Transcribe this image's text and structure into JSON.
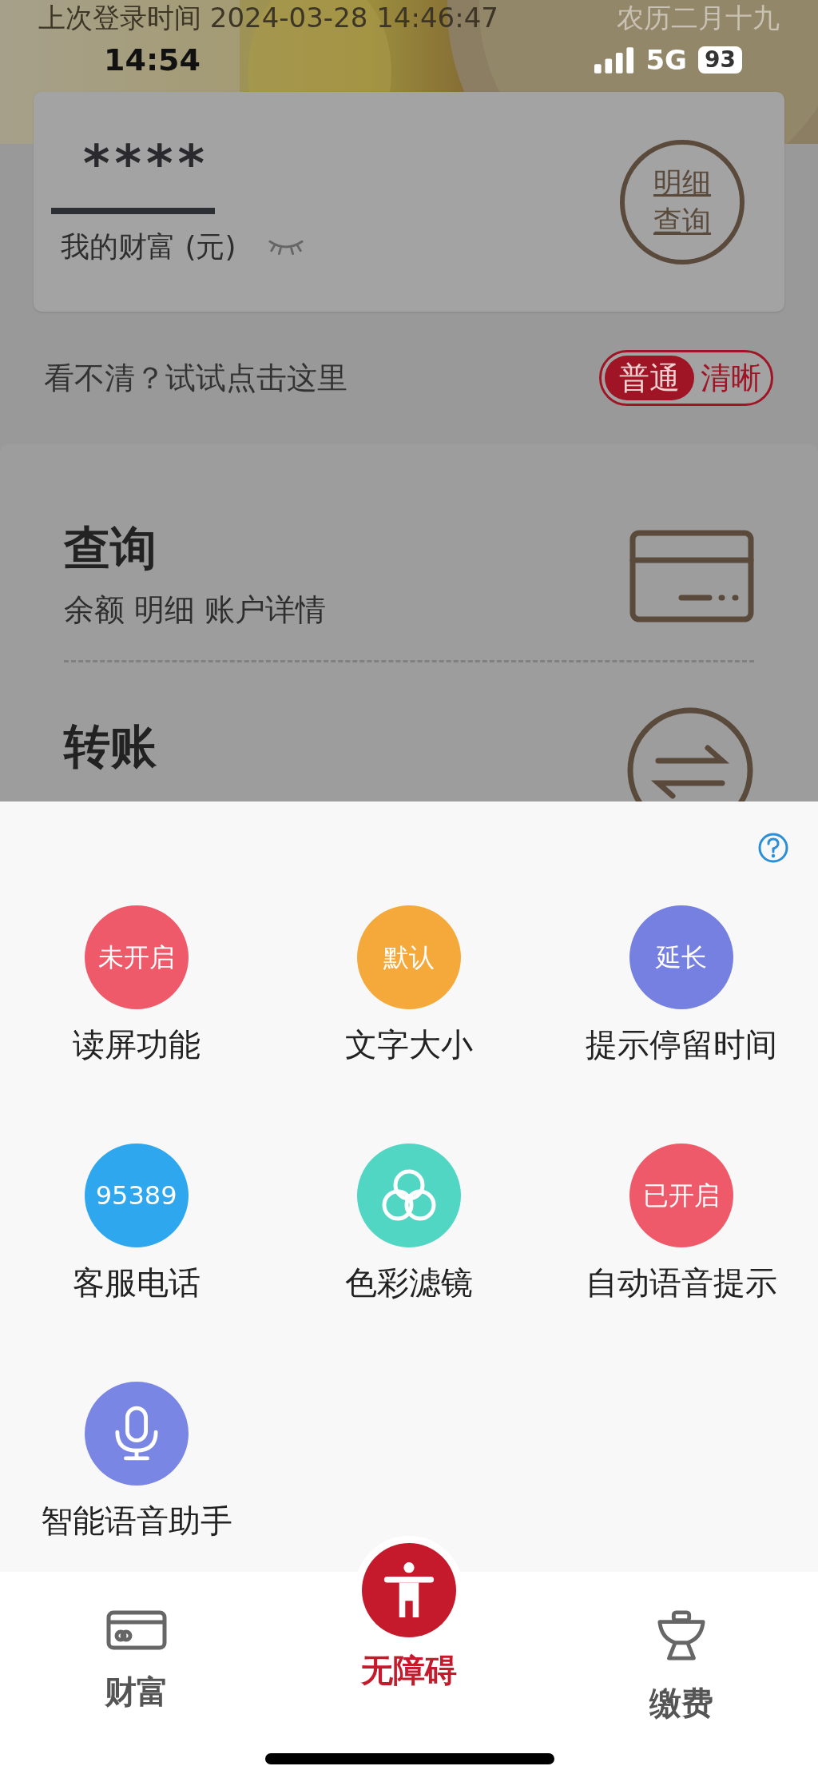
{
  "status_bar": {
    "last_login": "上次登录时间 2024-03-28 14:46:47",
    "lunar_date": "农历二月十九",
    "time": "14:54",
    "network": "5G",
    "battery": "93"
  },
  "wealth_card": {
    "amount": "****",
    "label": "我的财富 (元)",
    "detail_button": "明细查询"
  },
  "clarity": {
    "hint": "看不清？试试点击这里",
    "options": [
      {
        "label": "普通",
        "selected": true
      },
      {
        "label": "清晰",
        "selected": false
      }
    ]
  },
  "services": [
    {
      "kind": "card",
      "title": "查询",
      "subtitle": "余额 明细 账户详情"
    },
    {
      "kind": "transfer",
      "title": "转账"
    }
  ],
  "accessibility_panel": {
    "items": [
      {
        "kind": "text",
        "badge": "未开启",
        "label": "读屏功能",
        "color": "#ef5a6a"
      },
      {
        "kind": "text",
        "badge": "默认",
        "label": "文字大小",
        "color": "#f4a93a"
      },
      {
        "kind": "text",
        "badge": "延长",
        "label": "提示停留时间",
        "color": "#7580e0"
      },
      {
        "kind": "text",
        "badge": "95389",
        "label": "客服电话",
        "color": "#2fa7ee"
      },
      {
        "kind": "filter",
        "label": "色彩滤镜",
        "color": "#52d6c4"
      },
      {
        "kind": "text",
        "badge": "已开启",
        "label": "自动语音提示",
        "color": "#ef5a6a"
      },
      {
        "kind": "mic",
        "label": "智能语音助手",
        "color": "#7a86e4"
      }
    ]
  },
  "tab_bar": [
    {
      "kind": "card",
      "label": "财富",
      "selected": false
    },
    {
      "kind": "accessibility",
      "label": "无障碍",
      "selected": true
    },
    {
      "kind": "pot",
      "label": "缴费",
      "selected": false
    }
  ]
}
